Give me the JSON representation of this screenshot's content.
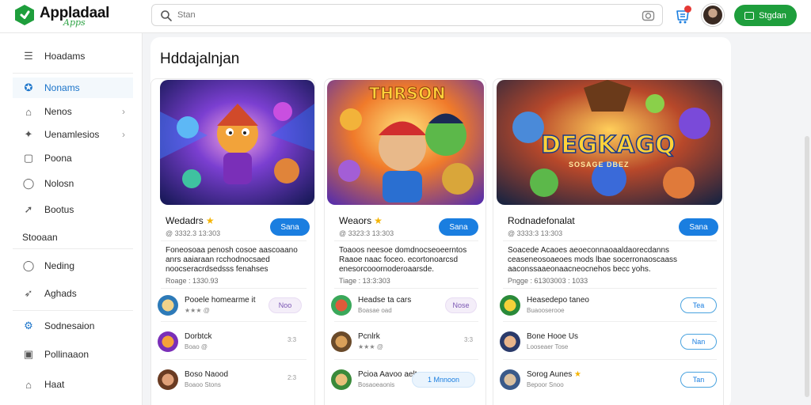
{
  "header": {
    "logo": "Appladaal",
    "logo_sub": "Apps",
    "search_placeholder": "Stan",
    "signin_label": "Stgdan"
  },
  "sidebar": {
    "items": [
      {
        "label": "Hoadams",
        "icon": "list-icon"
      },
      {
        "label": "Nonams",
        "icon": "star-badge-icon",
        "active": true
      },
      {
        "label": "Nenos",
        "icon": "home-icon",
        "chevron": true
      },
      {
        "label": "Uenamlesios",
        "icon": "puzzle-icon",
        "chevron": true
      },
      {
        "label": "Poona",
        "icon": "square-icon"
      },
      {
        "label": "Nolosn",
        "icon": "circle-icon"
      },
      {
        "label": "Bootus",
        "icon": "arrow-icon"
      }
    ],
    "heading": "Stooaan",
    "items2": [
      {
        "label": "Neding",
        "icon": "circle-icon"
      },
      {
        "label": "Aghads",
        "icon": "rocket-icon"
      },
      {
        "label": "Sodnesaion",
        "icon": "gear-icon"
      },
      {
        "label": "Pollinaaon",
        "icon": "square-icon"
      },
      {
        "label": "Haat",
        "icon": "home-icon"
      }
    ]
  },
  "main": {
    "title": "Hddajalnjan",
    "cards": [
      {
        "banner_text": "",
        "title": "Wedadrs",
        "meta": "@ 3332.3  13:303",
        "button": "Sana",
        "desc": [
          "Foneosoaa penosh cosoe aascoaano",
          "anrs aaiaraan rcchodnocsaed",
          "noocseracrdsedsss fenahses"
        ],
        "range": "Roage : 1330.93",
        "rows": [
          {
            "title": "Pooele homearme it",
            "sub": "★★★ @",
            "button": "Noo",
            "btn_style": "pink"
          },
          {
            "title": "Dorbtck",
            "sub": "Boao @",
            "meta": "3:3"
          },
          {
            "title": "Boso Naood",
            "sub": "Boaoo Stons",
            "meta": "2:3"
          }
        ]
      },
      {
        "banner_text": "THRSON",
        "title": "Weaors",
        "meta": "@ 3323:3  13:303",
        "button": "Sana",
        "desc": [
          "Toaoos neesoe domdnocseoeerntos",
          "Raaoe naac foceo. ecortonoarcsd",
          "enesorcooornoderoaarsde."
        ],
        "range": "Tiage : 13:3:303",
        "rows": [
          {
            "title": "Headse ta cars",
            "sub": "Boasae  oad",
            "button": "Nose",
            "btn_style": "pink"
          },
          {
            "title": "Pcnlrk",
            "sub": "★★★ @",
            "meta": "3:3"
          },
          {
            "title": "Pcioa Aavoo aelt",
            "sub": "Bosaoeaonis",
            "button": "1 Mnnoon",
            "btn_style": "blue-wide"
          }
        ]
      },
      {
        "banner_text": "DEGKAGQ",
        "banner_sub": "SOSAGE DBEZ",
        "title": "Rodnadefonalat",
        "meta": "@ 3333:3  13:303",
        "button": "Sana",
        "desc": [
          "Soacede  Acaoes aeoeconnaoaaldaorecdanns",
          "ceaseneosoaeoes mods lbae socerronaoscaass",
          "aaconssaaeonaacneocnehos becc yohs."
        ],
        "range": "Pngge : 61303003 : 1033",
        "rows": [
          {
            "title": "Heasedepo taneo",
            "sub": "Buaooserooe",
            "button": "Tea",
            "btn_style": "outline"
          },
          {
            "title": "Bone Hooe Us",
            "sub": "Looseaer Tose",
            "button": "Nan",
            "btn_style": "outline"
          },
          {
            "title": "Sorog Aunes",
            "sub": "Bepoor Snoo",
            "button": "Tan",
            "btn_style": "outline"
          }
        ]
      }
    ]
  }
}
